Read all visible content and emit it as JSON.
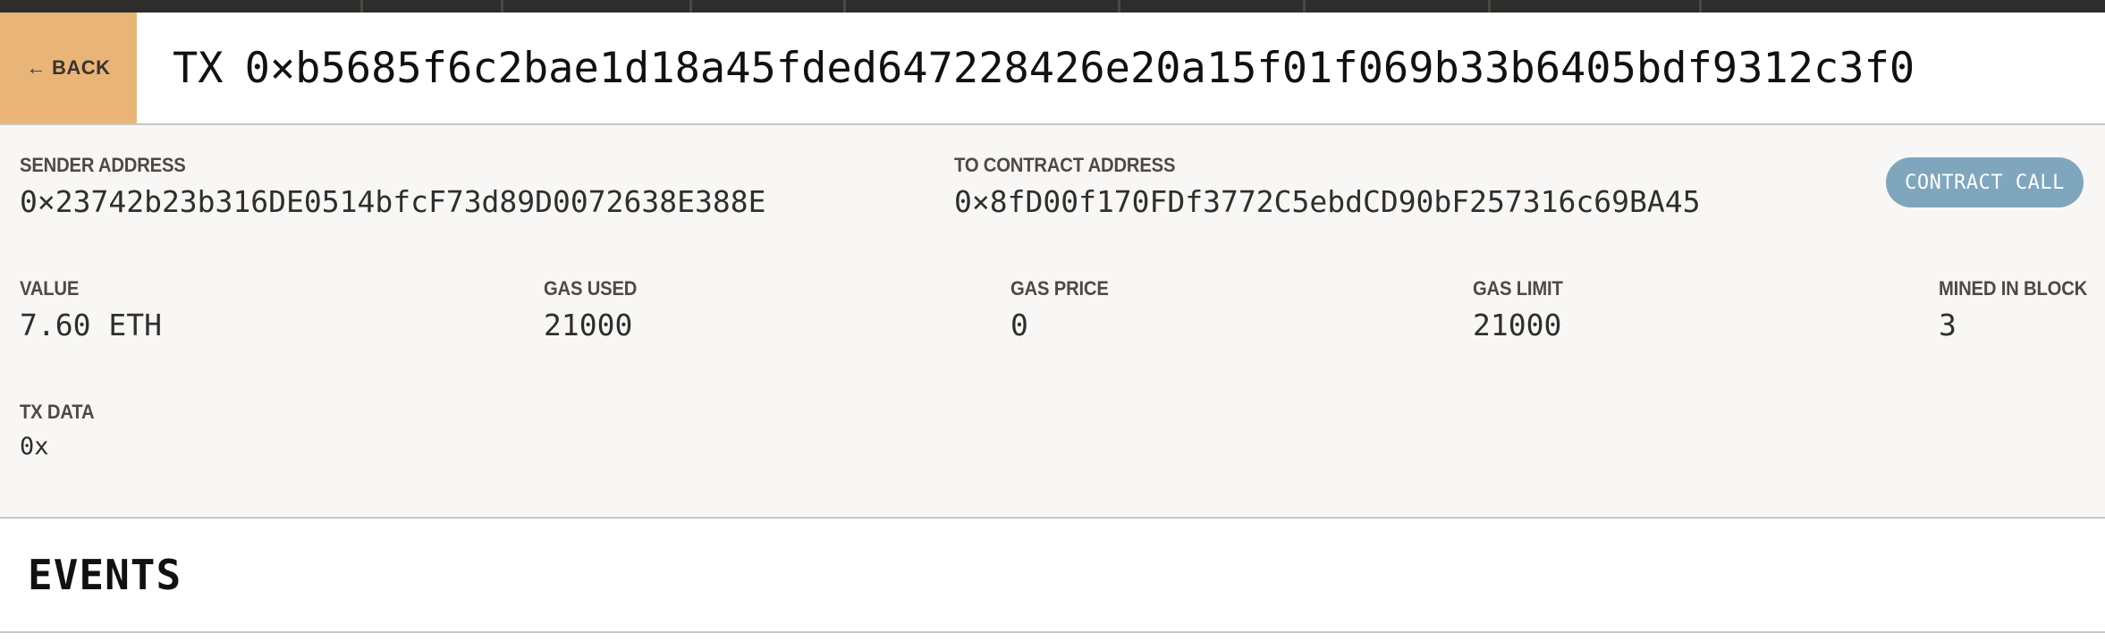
{
  "header": {
    "back_label": "BACK",
    "back_arrow": "←",
    "title_prefix": "TX",
    "tx_hash": "0×b5685f6c2bae1d18a45fded647228426e20a15f01f069b33b6405bdf9312c3f0"
  },
  "details": {
    "sender": {
      "label": "SENDER ADDRESS",
      "value": "0×23742b23b316DE0514bfcF73d89D0072638E388E"
    },
    "to_contract": {
      "label": "TO CONTRACT ADDRESS",
      "value": "0×8fD00f170FDf3772C5ebdCD90bF257316c69BA45"
    },
    "badge": "CONTRACT CALL",
    "value": {
      "label": "VALUE",
      "value": "7.60 ETH"
    },
    "gas_used": {
      "label": "GAS USED",
      "value": "21000"
    },
    "gas_price": {
      "label": "GAS PRICE",
      "value": "0"
    },
    "gas_limit": {
      "label": "GAS LIMIT",
      "value": "21000"
    },
    "mined_in_block": {
      "label": "MINED IN BLOCK",
      "value": "3"
    },
    "tx_data": {
      "label": "TX DATA",
      "value": "0x"
    }
  },
  "events": {
    "title": "EVENTS"
  },
  "colors": {
    "back_button": "#e9b478",
    "badge": "#7fa6bd",
    "details_bg": "#f8f7f5",
    "topbar": "#2f2d2b"
  }
}
